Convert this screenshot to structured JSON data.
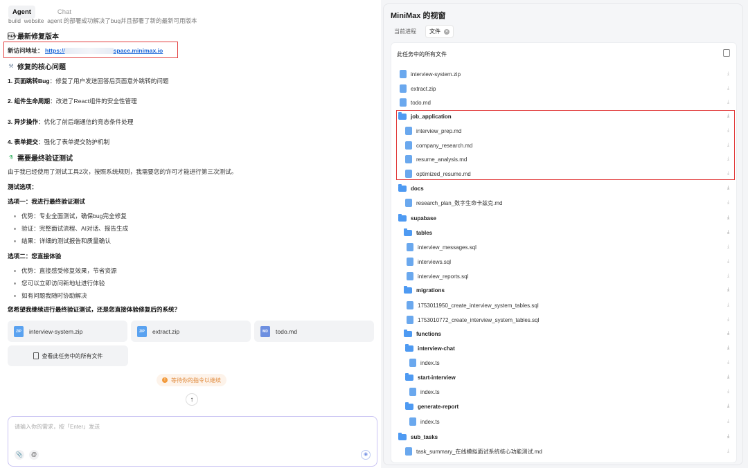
{
  "left": {
    "tabs": [
      {
        "label": "Agent"
      },
      {
        "label": "Chat"
      }
    ],
    "cutoff_text": "build_website_agent 的部署成功解决了bug并且部署了新的最新可用版本",
    "h1": "最新修复版本",
    "url_label": "新访问地址：",
    "url_prefix": "https://",
    "url_suffix": "space.minimax.io",
    "h2": "修复的核心问题",
    "fixes": [
      {
        "title": "1. 页面跳转Bug",
        "desc": "：修复了用户发送回答后页面意外跳转的问题"
      },
      {
        "title": "2. 组件生命周期",
        "desc": "：改进了React组件的安全性管理"
      },
      {
        "title": "3. 异步操作",
        "desc": "：优化了前后端通信的竞态条件处理"
      },
      {
        "title": "4. 表单提交",
        "desc": "：强化了表单提交防护机制"
      }
    ],
    "h3": "需要最终验证测试",
    "intro": "由于我已经使用了测试工具2次，按照系统规则，我需要您的许可才能进行第三次测试。",
    "options_label": "测试选项：",
    "option1_title": "选项一：我进行最终验证测试",
    "option1_items": [
      "优势：专业全面测试，确保bug完全修复",
      "验证：完整面试流程、AI对话、报告生成",
      "结果：详细的测试报告和质量确认"
    ],
    "option2_title": "选项二：您直接体验",
    "option2_items": [
      "优势：直接感受修复效果，节省资源",
      "您可以立即访问新地址进行体验",
      "如有问题我随时协助解决"
    ],
    "question": "您希望我继续进行最终验证测试，还是您直接体验修复后的系统？",
    "file_cards": [
      {
        "name": "interview-system.zip",
        "icon": "ZIP"
      },
      {
        "name": "extract.zip",
        "icon": "ZIP"
      },
      {
        "name": "todo.md",
        "icon": "MD"
      }
    ],
    "all_files_label": "查看此任务中的所有文件",
    "waiting_label": "等待你的指令以继续",
    "input_placeholder": "请输入你的需求，按「Enter」发送"
  },
  "right": {
    "title": "MiniMax 的视窗",
    "tabs": [
      {
        "label": "当前进程"
      },
      {
        "label": "文件"
      }
    ],
    "panel_heading": "此任务中的所有文件",
    "rows": [
      {
        "name": "interview-system.zip",
        "kind": "file",
        "indent": 0
      },
      {
        "name": "extract.zip",
        "kind": "file",
        "indent": 0
      },
      {
        "name": "todo.md",
        "kind": "file",
        "indent": 0
      },
      {
        "name": "job_application",
        "kind": "folder",
        "indent": 0
      },
      {
        "name": "interview_prep.md",
        "kind": "file",
        "indent": 1
      },
      {
        "name": "company_research.md",
        "kind": "file",
        "indent": 1
      },
      {
        "name": "resume_analysis.md",
        "kind": "file",
        "indent": 1
      },
      {
        "name": "optimized_resume.md",
        "kind": "file",
        "indent": 1
      },
      {
        "name": "docs",
        "kind": "folder",
        "indent": 0
      },
      {
        "name": "research_plan_数字生命卡兹克.md",
        "kind": "file",
        "indent": 1
      },
      {
        "name": "supabase",
        "kind": "folder",
        "indent": 0
      },
      {
        "name": "tables",
        "kind": "folder",
        "indent": 1
      },
      {
        "name": "interview_messages.sql",
        "kind": "file",
        "indent": 2
      },
      {
        "name": "interviews.sql",
        "kind": "file",
        "indent": 2
      },
      {
        "name": "interview_reports.sql",
        "kind": "file",
        "indent": 2
      },
      {
        "name": "migrations",
        "kind": "folder",
        "indent": 1
      },
      {
        "name": "1753011950_create_interview_system_tables.sql",
        "kind": "file",
        "indent": 2
      },
      {
        "name": "1753010772_create_interview_system_tables.sql",
        "kind": "file",
        "indent": 2
      },
      {
        "name": "functions",
        "kind": "folder",
        "indent": 1
      },
      {
        "name": "interview-chat",
        "kind": "folder",
        "indent": 2
      },
      {
        "name": "index.ts",
        "kind": "file",
        "indent": 3
      },
      {
        "name": "start-interview",
        "kind": "folder",
        "indent": 2
      },
      {
        "name": "index.ts",
        "kind": "file",
        "indent": 3
      },
      {
        "name": "generate-report",
        "kind": "folder",
        "indent": 2
      },
      {
        "name": "index.ts",
        "kind": "file",
        "indent": 3
      },
      {
        "name": "sub_tasks",
        "kind": "folder",
        "indent": 0
      },
      {
        "name": "task_summary_在线模拟面试系统核心功能测试.md",
        "kind": "file",
        "indent": 1
      }
    ]
  }
}
